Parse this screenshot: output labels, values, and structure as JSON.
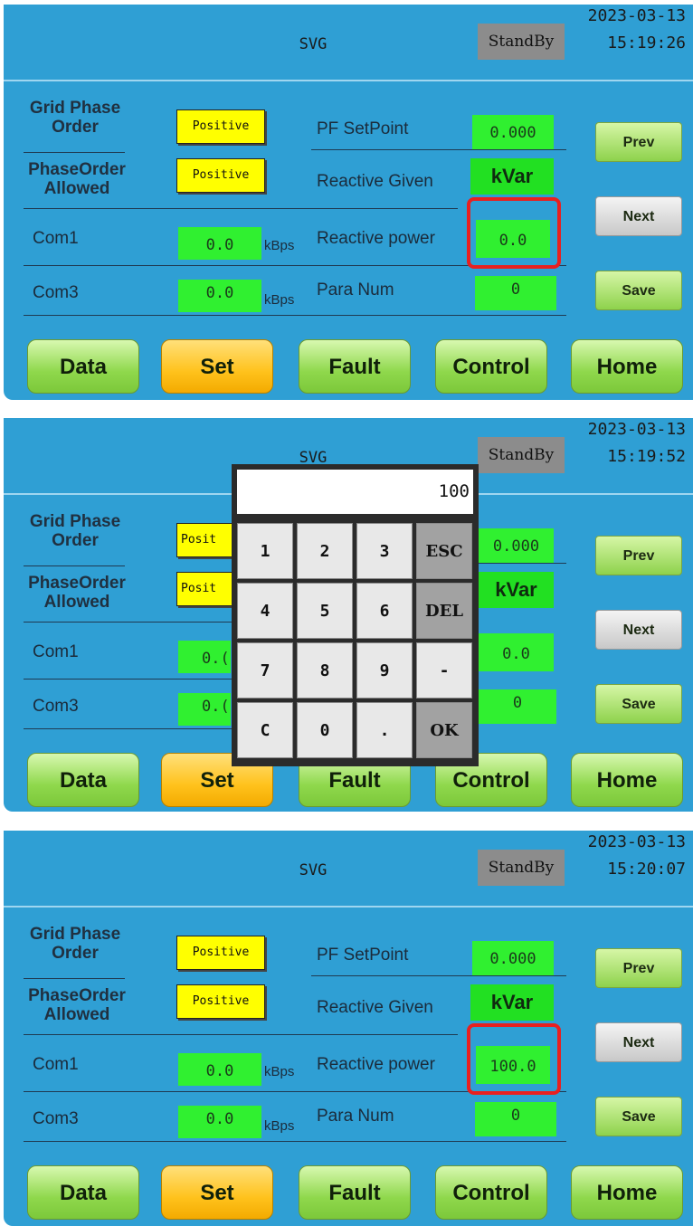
{
  "panels": [
    {
      "title": "SVG",
      "status": "StandBy",
      "date": "2023-03-13",
      "time": "15:19:26",
      "grid_phase_order_label": "Grid Phase Order",
      "grid_phase_order_value": "Positive",
      "phase_order_allowed_label": "PhaseOrder Allowed",
      "phase_order_allowed_value": "Positive",
      "com1_label": "Com1",
      "com1_value": "0.0",
      "com1_unit": "kBps",
      "com3_label": "Com3",
      "com3_value": "0.0",
      "com3_unit": "kBps",
      "pf_setpoint_label": "PF SetPoint",
      "pf_setpoint_value": "0.000",
      "reactive_given_label": "Reactive Given",
      "reactive_given_value": "kVar",
      "reactive_power_label": "Reactive power",
      "reactive_power_value": "0.0",
      "para_num_label": "Para Num",
      "para_num_value": "0",
      "prev_label": "Prev",
      "next_label": "Next",
      "save_label": "Save",
      "nav": [
        "Data",
        "Set",
        "Fault",
        "Control",
        "Home"
      ]
    },
    {
      "title": "SVG",
      "status": "StandBy",
      "date": "2023-03-13",
      "time": "15:19:52",
      "grid_phase_order_label": "Grid Phase Order",
      "grid_phase_order_value": "Posit",
      "phase_order_allowed_label": "PhaseOrder Allowed",
      "phase_order_allowed_value": "Posit",
      "com1_label": "Com1",
      "com1_value": "0.(",
      "com3_label": "Com3",
      "com3_value": "0.(",
      "pf_setpoint_value": "0.000",
      "reactive_given_value": "kVar",
      "reactive_power_value": "0.0",
      "para_num_value": "0",
      "prev_label": "Prev",
      "next_label": "Next",
      "save_label": "Save",
      "nav": [
        "Data",
        "Set",
        "Fault",
        "Control",
        "Home"
      ],
      "keypad": {
        "display": "100",
        "keys": [
          "1",
          "2",
          "3",
          "ESC",
          "4",
          "5",
          "6",
          "DEL",
          "7",
          "8",
          "9",
          "-",
          "C",
          "0",
          ".",
          "OK"
        ]
      }
    },
    {
      "title": "SVG",
      "status": "StandBy",
      "date": "2023-03-13",
      "time": "15:20:07",
      "grid_phase_order_label": "Grid Phase Order",
      "grid_phase_order_value": "Positive",
      "phase_order_allowed_label": "PhaseOrder Allowed",
      "phase_order_allowed_value": "Positive",
      "com1_label": "Com1",
      "com1_value": "0.0",
      "com1_unit": "kBps",
      "com3_label": "Com3",
      "com3_value": "0.0",
      "com3_unit": "kBps",
      "pf_setpoint_label": "PF SetPoint",
      "pf_setpoint_value": "0.000",
      "reactive_given_label": "Reactive Given",
      "reactive_given_value": "kVar",
      "reactive_power_label": "Reactive power",
      "reactive_power_value": "100.0",
      "para_num_label": "Para Num",
      "para_num_value": "0",
      "prev_label": "Prev",
      "next_label": "Next",
      "save_label": "Save",
      "nav": [
        "Data",
        "Set",
        "Fault",
        "Control",
        "Home"
      ]
    }
  ],
  "colors": {
    "screen_bg": "#2f9fd4",
    "value_green": "#30f030",
    "positive_yellow": "#ffff00",
    "status_grey": "#8c8c8c",
    "highlight_red": "#e82020",
    "nav_active": "#ffc21c"
  }
}
